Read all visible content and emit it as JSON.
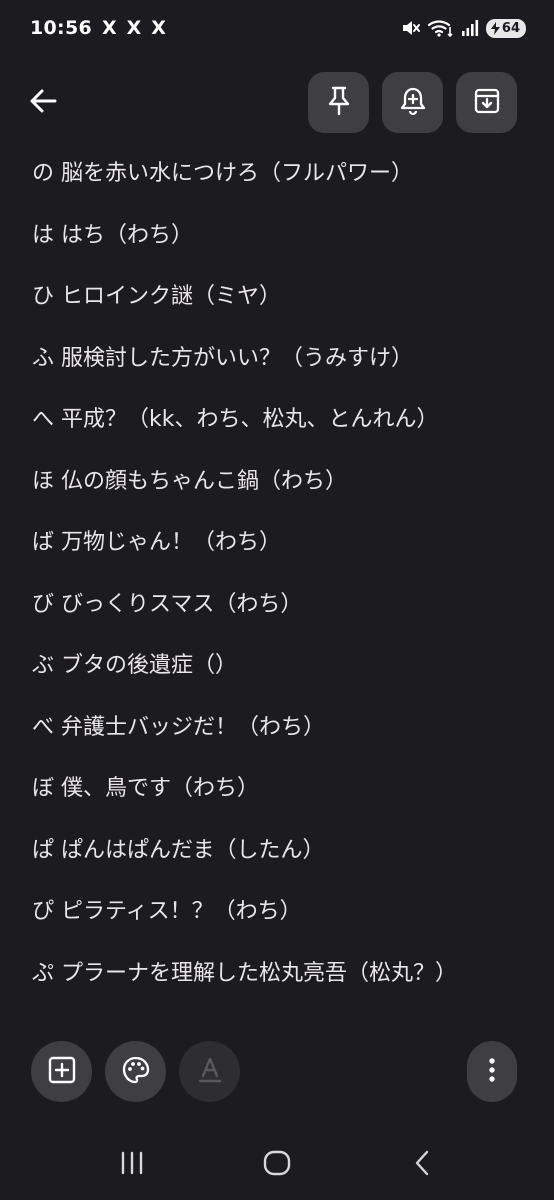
{
  "status_bar": {
    "time": "10:56",
    "notification_icons": [
      "X",
      "X",
      "X"
    ],
    "battery_level": "64"
  },
  "note": {
    "lines": [
      "の 脳を赤い水につけろ（フルパワー）",
      "は はち（わち）",
      "ひ ヒロインク謎（ミヤ）",
      "ふ 服検討した方がいい？（うみすけ）",
      "へ 平成？（kk、わち、松丸、とんれん）",
      "ほ 仏の顔もちゃんこ鍋（わち）",
      "ば 万物じゃん！（わち）",
      "び びっくりスマス（わち）",
      "ぶ ブタの後遺症（）",
      "べ 弁護士バッジだ！（わち）",
      "ぼ 僕、鳥です（わち）",
      "ぱ ぱんはぱんだま（したん）",
      "ぴ ピラティス！？（わち）",
      "ぷ プラーナを理解した松丸亮吾（松丸？）"
    ]
  },
  "colors": {
    "background": "#1c1b1f",
    "button": "#3f3e43",
    "text": "#e9e6ea"
  },
  "icons": {
    "back": "arrow-left-icon",
    "pin": "pin-icon",
    "reminder": "bell-plus-icon",
    "archive": "archive-icon",
    "add": "add-box-icon",
    "palette": "palette-icon",
    "text_format": "text-format-icon",
    "more": "more-vert-icon"
  }
}
